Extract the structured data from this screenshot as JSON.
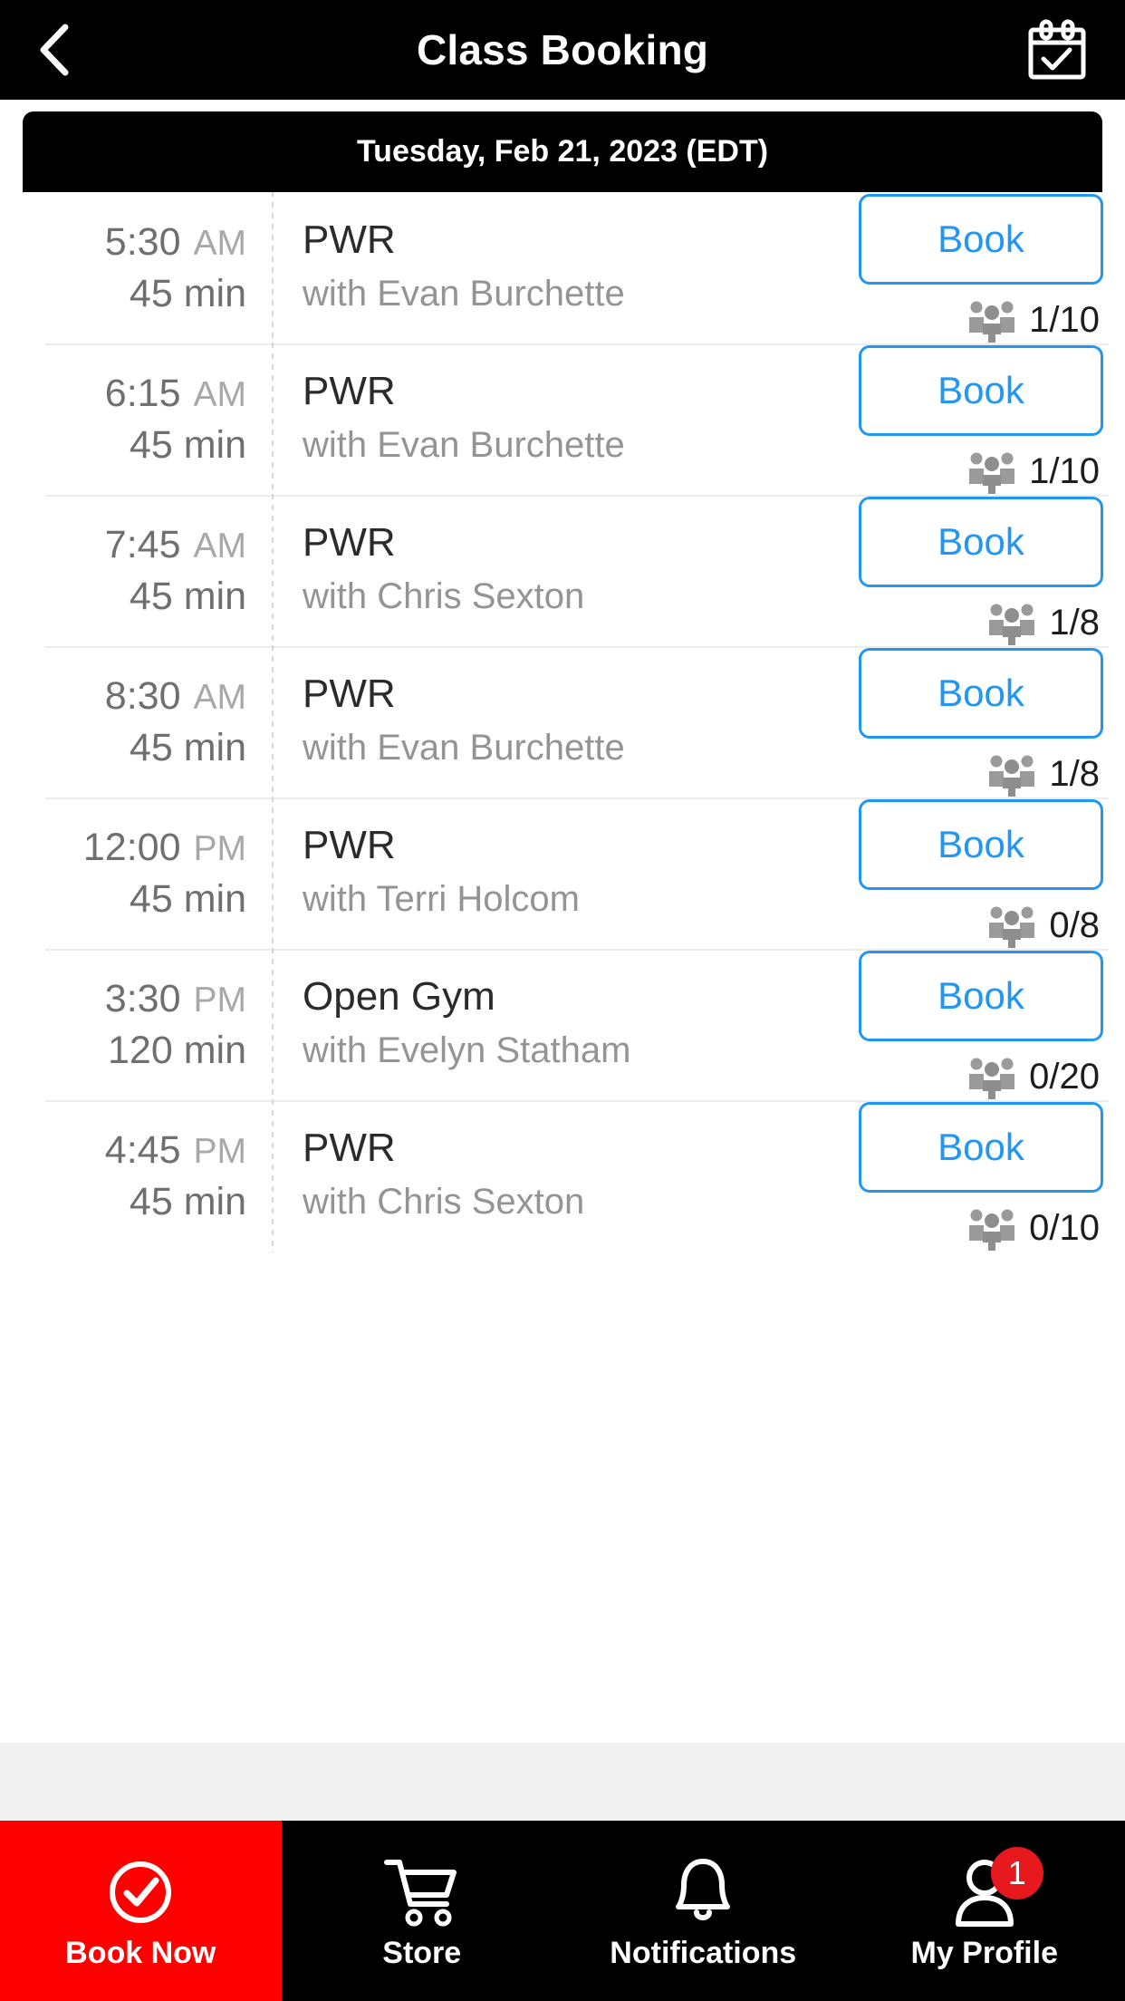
{
  "header": {
    "title": "Class Booking",
    "back_icon": "chevron-left-icon",
    "calendar_icon": "calendar-check-icon"
  },
  "date_bar": {
    "label": "Tuesday, Feb 21, 2023 (EDT)"
  },
  "colors": {
    "accent_blue": "#2196f3",
    "active_red": "#ff0000",
    "badge_red": "#e8191c",
    "header_black": "#000000",
    "filler_gray": "#f1f1f1"
  },
  "classes": [
    {
      "time": "5:30",
      "ampm": "AM",
      "duration": "45 min",
      "name": "PWR",
      "instructor": "with Evan Burchette",
      "book_label": "Book",
      "capacity": "1/10"
    },
    {
      "time": "6:15",
      "ampm": "AM",
      "duration": "45 min",
      "name": "PWR",
      "instructor": "with Evan Burchette",
      "book_label": "Book",
      "capacity": "1/10"
    },
    {
      "time": "7:45",
      "ampm": "AM",
      "duration": "45 min",
      "name": "PWR",
      "instructor": "with Chris Sexton",
      "book_label": "Book",
      "capacity": "1/8"
    },
    {
      "time": "8:30",
      "ampm": "AM",
      "duration": "45 min",
      "name": "PWR",
      "instructor": "with Evan Burchette",
      "book_label": "Book",
      "capacity": "1/8"
    },
    {
      "time": "12:00",
      "ampm": "PM",
      "duration": "45 min",
      "name": "PWR",
      "instructor": "with Terri Holcom",
      "book_label": "Book",
      "capacity": "0/8"
    },
    {
      "time": "3:30",
      "ampm": "PM",
      "duration": "120 min",
      "name": "Open Gym",
      "instructor": "with Evelyn Statham",
      "book_label": "Book",
      "capacity": "0/20"
    },
    {
      "time": "4:45",
      "ampm": "PM",
      "duration": "45 min",
      "name": "PWR",
      "instructor": "with Chris Sexton",
      "book_label": "Book",
      "capacity": "0/10"
    }
  ],
  "bottom_nav": {
    "items": [
      {
        "label": "Book Now",
        "icon": "check-circle-icon",
        "active": true,
        "badge": null
      },
      {
        "label": "Store",
        "icon": "shopping-cart-icon",
        "active": false,
        "badge": null
      },
      {
        "label": "Notifications",
        "icon": "bell-icon",
        "active": false,
        "badge": null
      },
      {
        "label": "My Profile",
        "icon": "user-icon",
        "active": false,
        "badge": "1"
      }
    ]
  }
}
